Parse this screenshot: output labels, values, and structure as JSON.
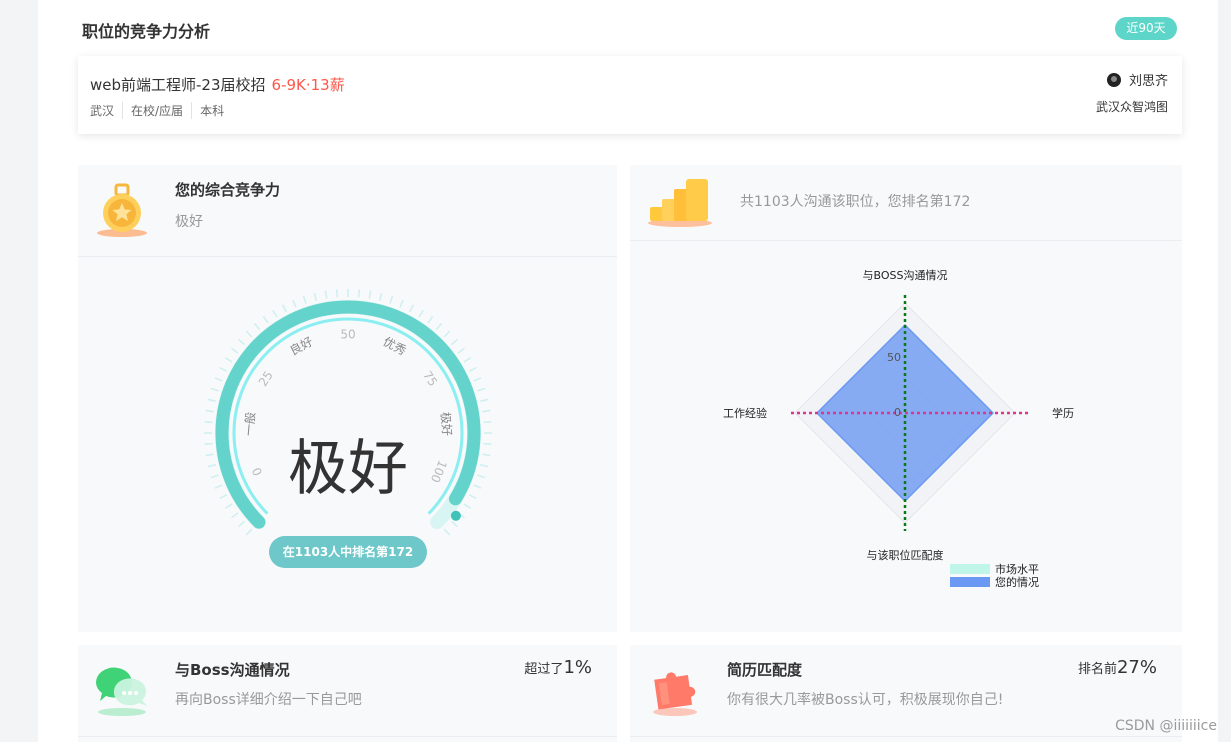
{
  "header": {
    "title": "职位的竞争力分析",
    "period_badge": "近90天"
  },
  "job": {
    "title": "web前端工程师-23届校招",
    "salary": "6-9K·13薪",
    "tags": [
      "武汉",
      "在校/应届",
      "本科"
    ],
    "recruiter": "刘思齐",
    "company": "武汉众智鸿图"
  },
  "overall": {
    "title": "您的综合竞争力",
    "level": "极好",
    "gauge_value": 95,
    "gauge_ticks": [
      "0",
      "一般",
      "25",
      "良好",
      "50",
      "优秀",
      "75",
      "极好",
      "100"
    ],
    "center_text": "极好",
    "rank_button": "在1103人中排名第172"
  },
  "ranking": {
    "text": "共1103人沟通该职位，您排名第172"
  },
  "chart_data": {
    "type": "radar",
    "axes": [
      "与BOSS沟通情况",
      "学历",
      "与该职位匹配度",
      "工作经验"
    ],
    "tick_labels": [
      "0",
      "50"
    ],
    "series": [
      {
        "name": "市场水平",
        "values": [
          0,
          0,
          0,
          0
        ],
        "color": "#c0f5ea"
      },
      {
        "name": "您的情况",
        "values": [
          80,
          80,
          80,
          80
        ],
        "color": "#6b98f2"
      }
    ],
    "legend": [
      "市场水平",
      "您的情况"
    ]
  },
  "boss_comm": {
    "title": "与Boss沟通情况",
    "subtitle": "再向Boss详细介绍一下自己吧",
    "stat_prefix": "超过了",
    "stat_value": "1%"
  },
  "resume_match": {
    "title": "简历匹配度",
    "subtitle": "你有很大几率被Boss认可，积极展现你自己!",
    "stat_prefix": "排名前",
    "stat_value": "27%"
  },
  "watermark": "CSDN @iiiiiiice",
  "colors": {
    "teal": "#5dd5c8",
    "salary": "#fe574a",
    "radar_fill": "#6b98f2"
  }
}
